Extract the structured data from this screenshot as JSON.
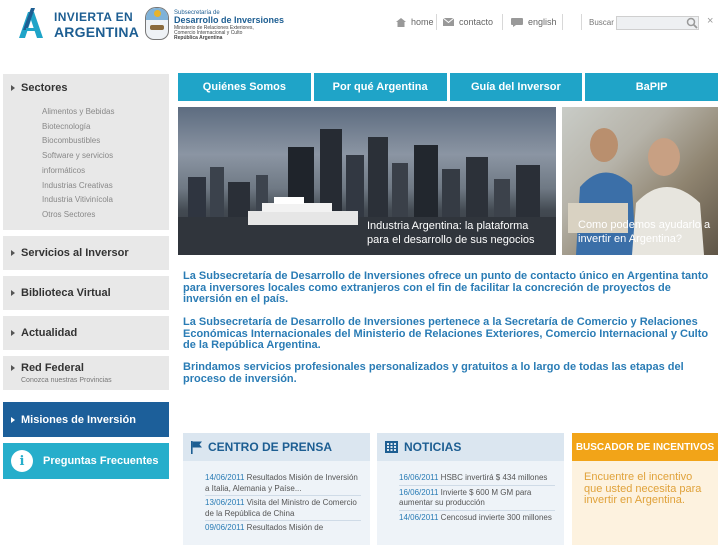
{
  "header": {
    "logo_line1": "INVIERTA EN",
    "logo_line2": "ARGENTINA",
    "gov_line1": "Subsecretaría de",
    "gov_line2": "Desarrollo de Inversiones",
    "gov_line3": "Ministerio de Relaciones Exteriores,",
    "gov_line4": "Comercio Internacional y Culto",
    "gov_line5": "República Argentina"
  },
  "topnav": {
    "home": "home",
    "contacto": "contacto",
    "english": "english",
    "search_label": "Buscar",
    "search_value": "",
    "close": "×"
  },
  "sidebar": {
    "sectores_label": "Sectores",
    "sectores": [
      "Alimentos y Bebidas",
      "Biotecnología",
      "Biocombustibles",
      "Software y servicios",
      "informáticos",
      "Industrias Creativas",
      "Industria Vitivinícola",
      "Otros Sectores"
    ],
    "servicios": "Servicios al Inversor",
    "biblioteca": "Biblioteca Virtual",
    "actualidad": "Actualidad",
    "red_federal": "Red Federal",
    "red_federal_sub": "Conozca nuestras Provincias",
    "misiones": "Misiones de Inversión",
    "preguntas": "Preguntas Frecuentes",
    "preguntas_icon": "i"
  },
  "tabs": [
    "Quiénes Somos",
    "Por qué Argentina",
    "Guía del Inversor",
    "BaPIP"
  ],
  "banners": {
    "left_caption": "Industria Argentina: la plataforma para el desarrollo de sus negocios",
    "right_caption": "Como podemos ayudarlo a invertir en Argentina?"
  },
  "intro": {
    "p1": "La Subsecretaría de Desarrollo de Inversiones ofrece un punto de contacto único en Argentina tanto para inversores locales como extranjeros con el fin de facilitar la concreción de proyectos de inversión en el país.",
    "p2": "La Subsecretaría de Desarrollo de Inversiones pertenece a la Secretaría de Comercio y Relaciones Económicas Internacionales del Ministerio de Relaciones Exteriores, Comercio Internacional y Culto de la República Argentina.",
    "p3": "Brindamos servicios profesionales personalizados y gratuitos a lo largo de todas las etapas del proceso de inversión."
  },
  "prensa": {
    "title": "CENTRO DE PRENSA",
    "items": [
      {
        "date": "14/06/2011",
        "text": " Resultados Misión de Inversión a Italia, Alemania y Paíse..."
      },
      {
        "date": "13/06/2011",
        "text": " Visita del Ministro de Comercio de la República de China"
      },
      {
        "date": "09/06/2011",
        "text": " Resultados Misión de"
      }
    ]
  },
  "noticias": {
    "title": "NOTICIAS",
    "items": [
      {
        "date": "16/06/2011",
        "text": " HSBC invertirá $ 434 millones"
      },
      {
        "date": "16/06/2011",
        "text": " Invierte $ 600 M GM para aumentar su producción"
      },
      {
        "date": "14/06/2011",
        "text": " Cencosud invierte 300 millones"
      }
    ]
  },
  "buscador": {
    "title": "BUSCADOR DE INCENTIVOS",
    "text": "Encuentre el incentivo que usted necesita para invertir en Argentina."
  },
  "colors": {
    "tab_blue": "#1fa4c8",
    "dark_blue": "#1c5f9a",
    "text_blue": "#2a7cb5",
    "orange": "#f2a418"
  }
}
